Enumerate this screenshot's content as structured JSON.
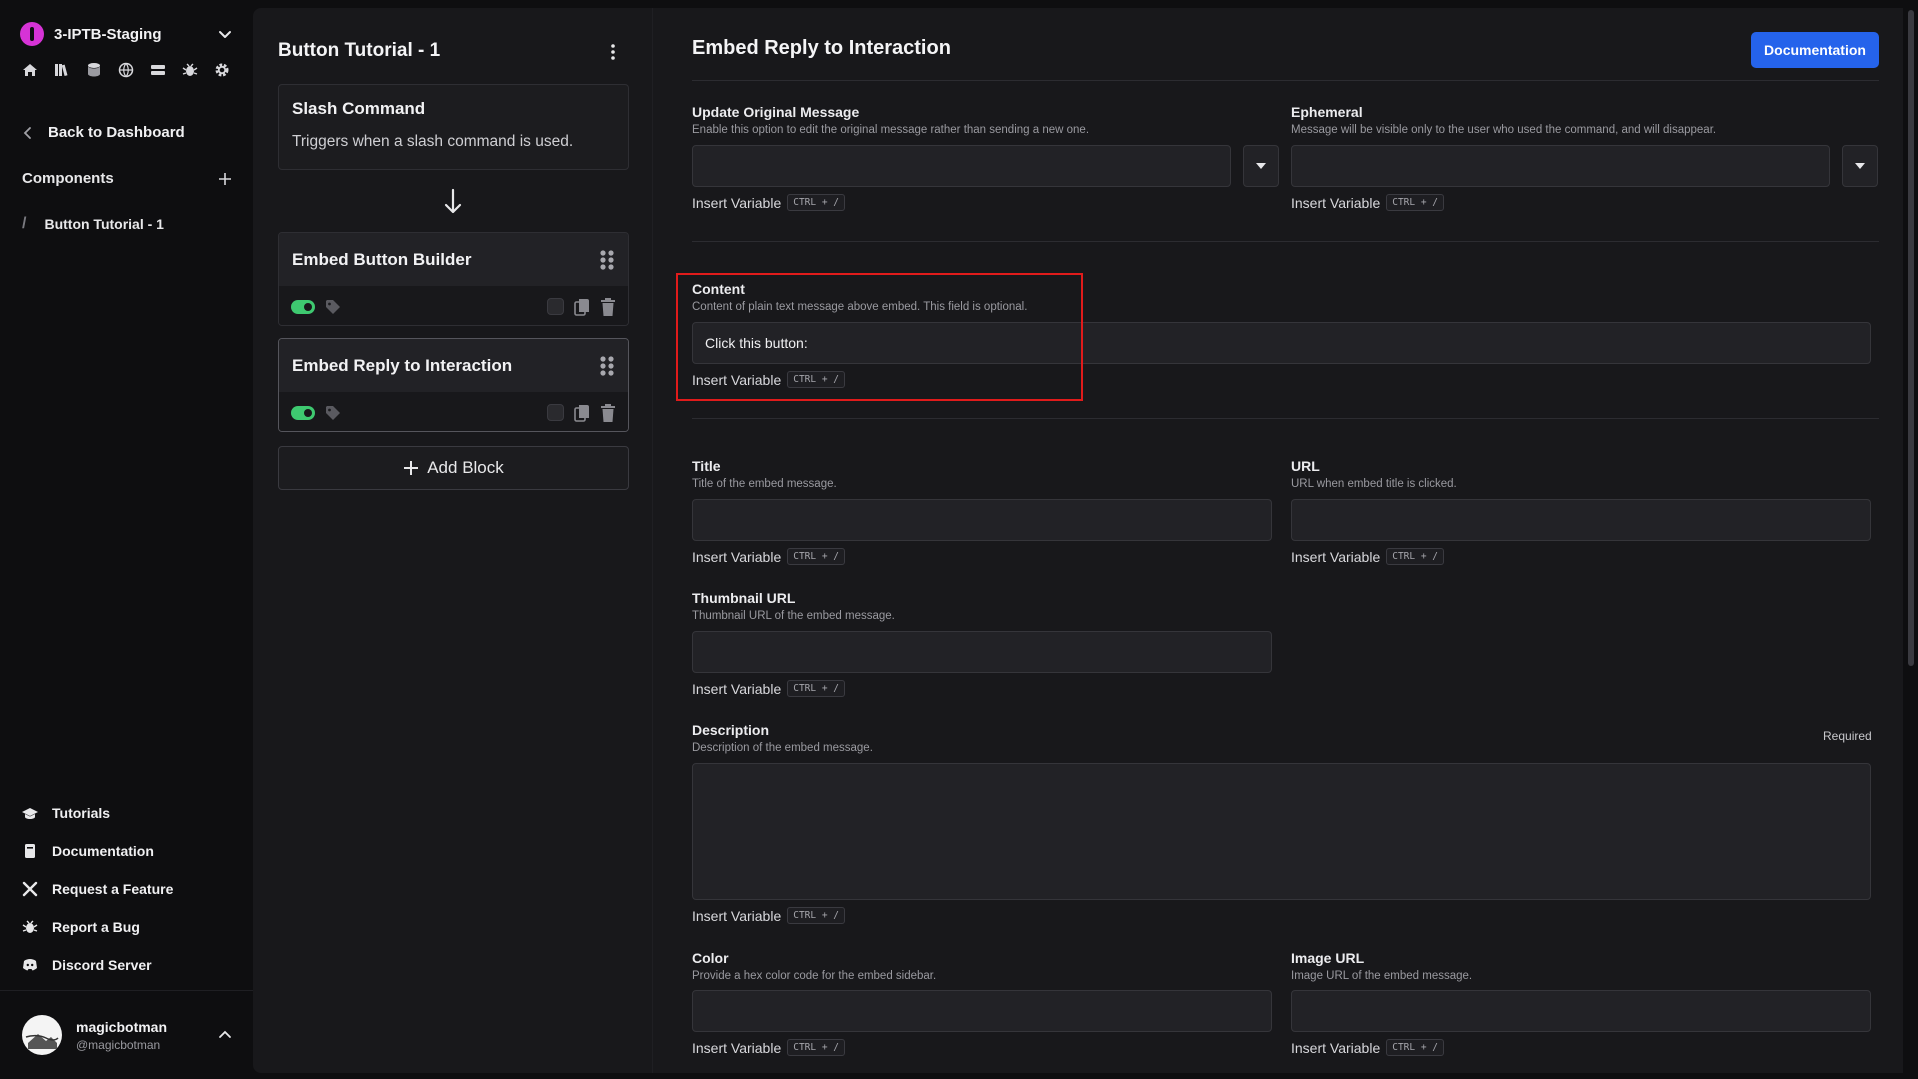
{
  "sidebar": {
    "workspace_name": "3-IPTB-Staging",
    "accent": "#d633d6",
    "back_label": "Back to Dashboard",
    "components_label": "Components",
    "component_item": "Button Tutorial - 1",
    "bottom_links": [
      "Tutorials",
      "Documentation",
      "Request a Feature",
      "Report a Bug",
      "Discord Server"
    ],
    "user_name": "magicbotman",
    "user_handle": "@magicbotman"
  },
  "flow": {
    "title": "Button Tutorial - 1",
    "trigger_title": "Slash Command",
    "trigger_desc": "Triggers when a slash command is used.",
    "blocks": [
      "Embed Button Builder",
      "Embed Reply to Interaction"
    ],
    "add_block_label": "Add Block"
  },
  "settings": {
    "title": "Embed Reply to Interaction",
    "doc_button": "Documentation",
    "insert_label": "Insert Variable",
    "insert_kbd": "CTRL + /",
    "required_label": "Required",
    "update_original": {
      "label": "Update Original Message",
      "hint": "Enable this option to edit the original message rather than sending a new one."
    },
    "ephemeral": {
      "label": "Ephemeral",
      "hint": "Message will be visible only to the user who used the command, and will disappear."
    },
    "content": {
      "label": "Content",
      "hint": "Content of plain text message above embed. This field is optional.",
      "value": "Click this button:"
    },
    "title_field": {
      "label": "Title",
      "hint": "Title of the embed message."
    },
    "url_field": {
      "label": "URL",
      "hint": "URL when embed title is clicked."
    },
    "thumbnail_field": {
      "label": "Thumbnail URL",
      "hint": "Thumbnail URL of the embed message."
    },
    "description_field": {
      "label": "Description",
      "hint": "Description of the embed message."
    },
    "color_field": {
      "label": "Color",
      "hint": "Provide a hex color code for the embed sidebar."
    },
    "image_field": {
      "label": "Image URL",
      "hint": "Image URL of the embed message."
    }
  },
  "colors": {
    "primary_button": "#2563eb",
    "toggle_on": "#3ec970",
    "highlight": "#e01b1b"
  }
}
